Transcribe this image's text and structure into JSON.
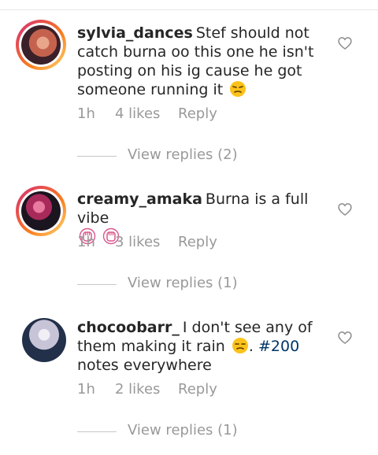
{
  "comments": [
    {
      "username": "sylvia_dances",
      "text": "Stef should not catch burna oo this one he isn't posting on his ig cause he got someone running it",
      "trailing_text": "",
      "emoji": "unamused-face-emoji",
      "time": "1h",
      "likes": "4 likes",
      "reply_label": "Reply",
      "view_replies": "View replies (2)",
      "avatar_colors": [
        "#3a2028",
        "#c4624e",
        "#e8a58a"
      ]
    },
    {
      "username": "creamy_amaka",
      "text": "Burna is a full vibe",
      "trailing_text": "",
      "emoji": "raised-fist-emoji",
      "time": "1h",
      "likes": "3 likes",
      "reply_label": "Reply",
      "view_replies": "View replies (1)",
      "avatar_colors": [
        "#1b1520",
        "#a82a5a",
        "#e87aa0"
      ]
    },
    {
      "username": "chocoobarr_",
      "text": "I don't see any of them making it rain",
      "hashtag": "#200",
      "trailing_text": "notes everywhere",
      "emoji": "unamused-face-emoji",
      "time": "1h",
      "likes": "2 likes",
      "reply_label": "Reply",
      "view_replies": "View replies (1)",
      "avatar_colors": [
        "#22304a",
        "#c8c4d8",
        "#f1eef6"
      ]
    }
  ],
  "colors": {
    "primary_text": "#262626",
    "secondary_text": "#999999",
    "hashtag": "#003569",
    "heart_outline": "#8e8e8e"
  }
}
